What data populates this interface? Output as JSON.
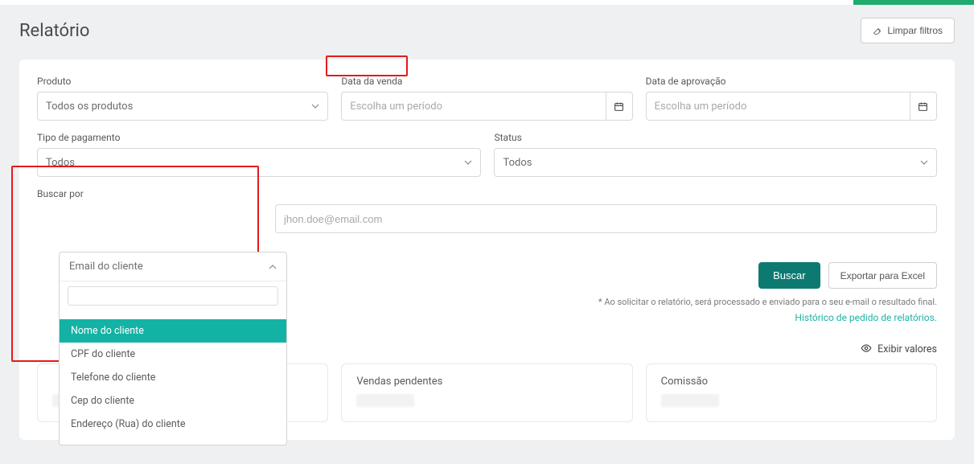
{
  "header": {
    "title": "Relatório",
    "clear_filters": "Limpar filtros"
  },
  "filters": {
    "produto": {
      "label": "Produto",
      "value": "Todos os produtos"
    },
    "data_venda": {
      "label": "Data da venda",
      "placeholder": "Escolha um período"
    },
    "data_aprovacao": {
      "label": "Data de aprovação",
      "placeholder": "Escolha um período"
    },
    "tipo_pagamento": {
      "label": "Tipo de pagamento",
      "value": "Todos"
    },
    "status": {
      "label": "Status",
      "value": "Todos"
    },
    "buscar_por": {
      "label": "Buscar por",
      "selected": "Email do cliente",
      "options": [
        "Nome do cliente",
        "CPF do cliente",
        "Telefone do cliente",
        "Cep do cliente",
        "Endereço (Rua) do cliente"
      ],
      "cutoff": " "
    },
    "busca": {
      "placeholder": "jhon.doe@email.com"
    }
  },
  "actions": {
    "buscar": "Buscar",
    "exportar": "Exportar para Excel",
    "note": "* Ao solicitar o relatório, será processado e enviado para o seu e-mail o resultado final.",
    "historico_link": "Histórico de pedido de relatórios.",
    "exibir_valores": "Exibir valores"
  },
  "stats": {
    "pending": "Vendas pendentes",
    "commission": "Comissão"
  }
}
